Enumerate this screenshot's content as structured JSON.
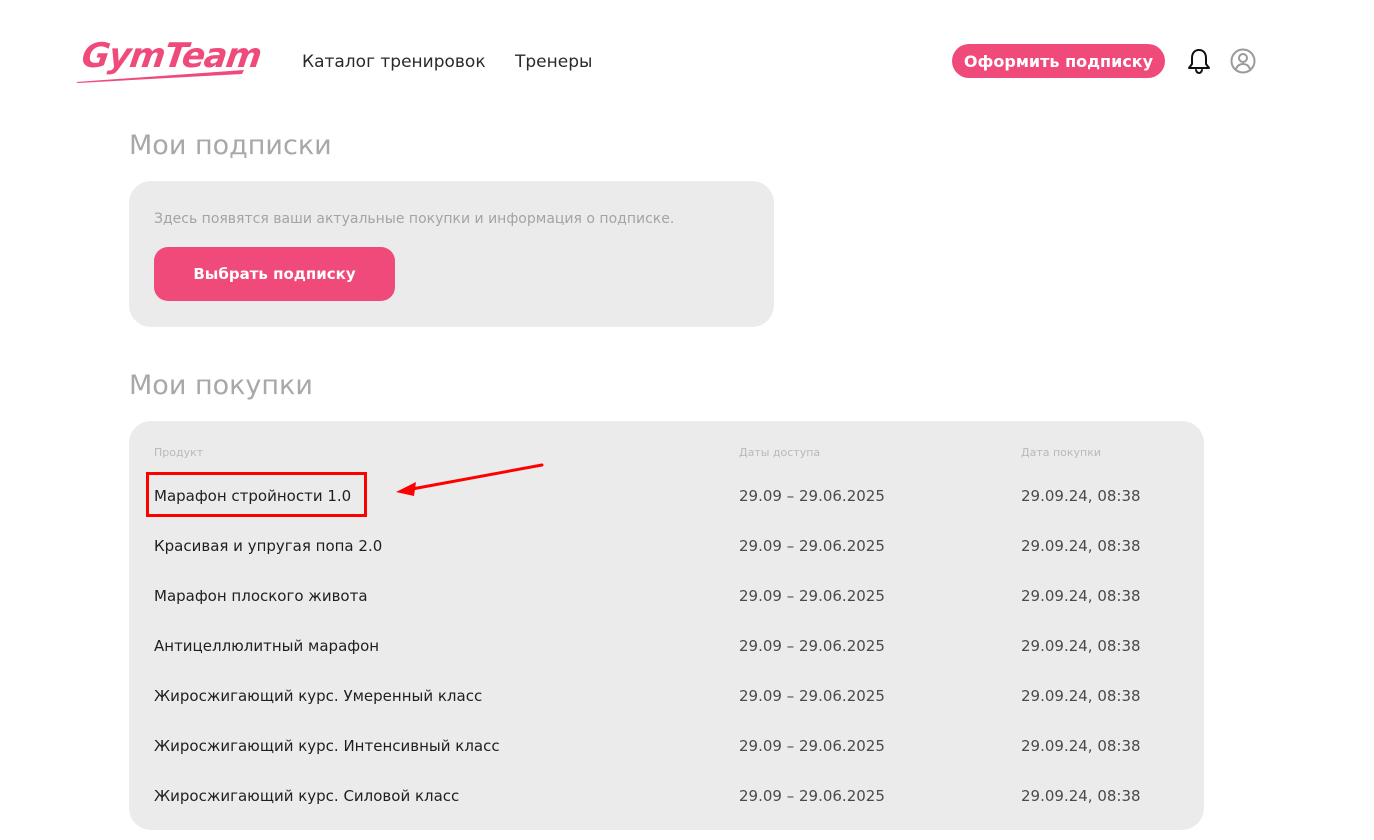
{
  "header": {
    "logo_text": "GymTeam",
    "nav": {
      "catalog": "Каталог тренировок",
      "trainers": "Тренеры"
    },
    "subscribe_label": "Оформить подписку",
    "icons": {
      "bell": "bell-icon",
      "profile": "user-circle-icon"
    }
  },
  "subscriptions": {
    "title": "Мои подписки",
    "info": "Здесь появятся ваши актуальные покупки и информация о подписке.",
    "choose_label": "Выбрать подписку"
  },
  "purchases": {
    "title": "Мои покупки",
    "columns": {
      "product": "Продукт",
      "access": "Даты доступа",
      "date": "Дата покупки"
    },
    "rows": [
      {
        "product": "Марафон стройности 1.0",
        "access": "29.09 – 29.06.2025",
        "date": "29.09.24, 08:38"
      },
      {
        "product": "Красивая и упругая попа 2.0",
        "access": "29.09 – 29.06.2025",
        "date": "29.09.24, 08:38"
      },
      {
        "product": "Марафон плоского живота",
        "access": "29.09 – 29.06.2025",
        "date": "29.09.24, 08:38"
      },
      {
        "product": "Антицеллюлитный марафон",
        "access": "29.09 – 29.06.2025",
        "date": "29.09.24, 08:38"
      },
      {
        "product": "Жиросжигающий курс. Умеренный класс",
        "access": "29.09 – 29.06.2025",
        "date": "29.09.24, 08:38"
      },
      {
        "product": "Жиросжигающий курс. Интенсивный класс",
        "access": "29.09 – 29.06.2025",
        "date": "29.09.24, 08:38"
      },
      {
        "product": "Жиросжигающий курс. Силовой класс",
        "access": "29.09 – 29.06.2025",
        "date": "29.09.24, 08:38"
      }
    ]
  },
  "colors": {
    "accent": "#ef4a7a",
    "card_bg": "#ebebeb",
    "annotation": "#ff0000"
  }
}
